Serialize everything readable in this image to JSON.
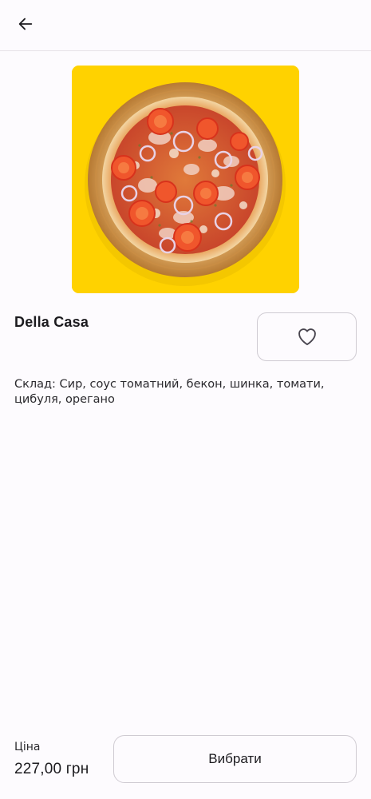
{
  "top_bar": {
    "back_icon": "arrow-left-icon"
  },
  "product": {
    "image_icon": "pizza-image",
    "name": "Della Casa",
    "composition": "Склад: Сир, соус томатний, бекон, шинка, томати, цибуля, орегано",
    "favorite_icon": "heart-outline-icon"
  },
  "footer": {
    "price_label": "Ціна",
    "price_value": "227,00 грн",
    "select_button_label": "Вибрати"
  },
  "colors": {
    "background": "#fdfbfe",
    "image_background": "#ffd200",
    "border": "#cfcbd2",
    "text": "#1c1b1f"
  }
}
